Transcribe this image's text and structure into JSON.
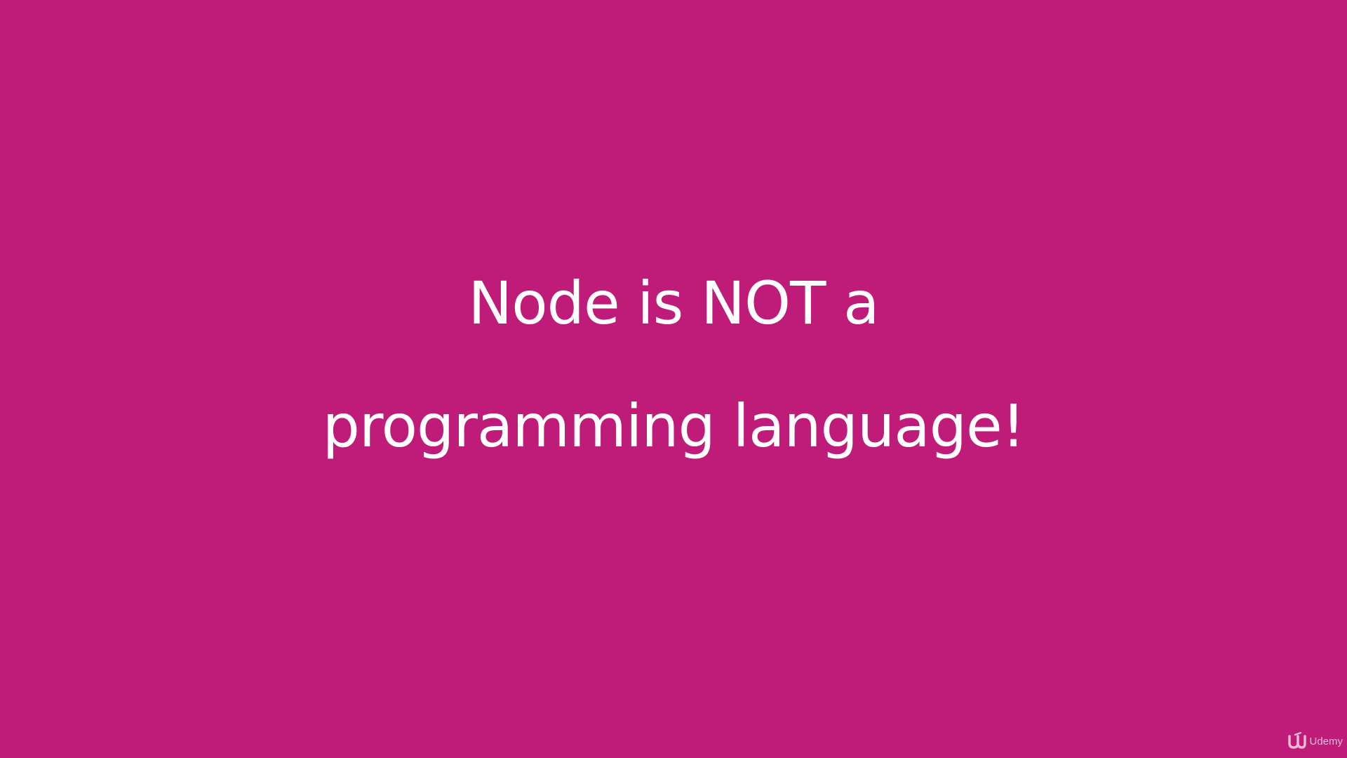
{
  "slide": {
    "line1": "Node is NOT a",
    "line2": "programming language!"
  },
  "watermark": {
    "text": "Udemy",
    "icon": "udemy-logo-icon"
  },
  "colors": {
    "background": "#bf1b79",
    "text": "#ffffff"
  }
}
